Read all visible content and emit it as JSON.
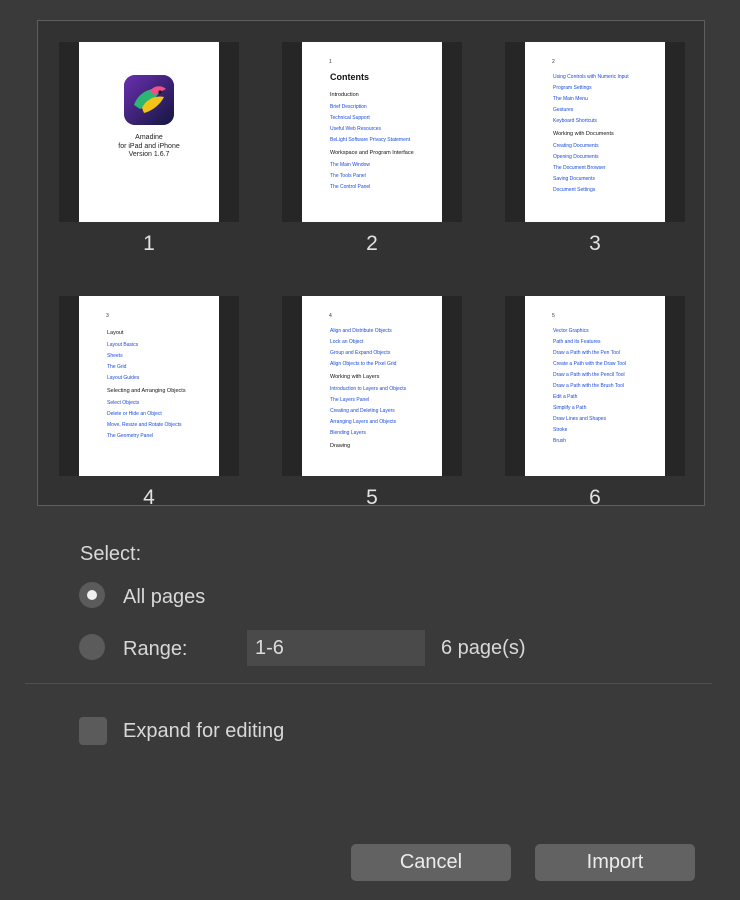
{
  "pages": [
    {
      "number": "1",
      "type": "cover",
      "cover": {
        "line1": "Amadine",
        "line2": "for iPad and iPhone",
        "line3": "Version 1.6.7"
      }
    },
    {
      "number": "2",
      "page_no": "1",
      "heading": "Contents",
      "lines": [
        {
          "t": "Introduction",
          "s": true
        },
        {
          "t": "Brief Description",
          "s": false
        },
        {
          "t": "Technical Support",
          "s": false
        },
        {
          "t": "Useful Web Resources",
          "s": false
        },
        {
          "t": "BeLight Software Privacy Statement",
          "s": false
        },
        {
          "t": "Workspace and Program Interface",
          "s": true
        },
        {
          "t": "The Main Window",
          "s": false
        },
        {
          "t": "The Tools Panel",
          "s": false
        },
        {
          "t": "The Control Panel",
          "s": false
        }
      ]
    },
    {
      "number": "3",
      "page_no": "2",
      "heading": "",
      "lines": [
        {
          "t": "Using Controls with Numeric Input",
          "s": false
        },
        {
          "t": "Program Settings",
          "s": false
        },
        {
          "t": "The Main Menu",
          "s": false
        },
        {
          "t": "Gestures",
          "s": false
        },
        {
          "t": "Keyboard Shortcuts",
          "s": false
        },
        {
          "t": "Working with Documents",
          "s": true
        },
        {
          "t": "Creating Documents",
          "s": false
        },
        {
          "t": "Opening Documents",
          "s": false
        },
        {
          "t": "The Document Browser",
          "s": false
        },
        {
          "t": "Saving Documents",
          "s": false
        },
        {
          "t": "Document Settings",
          "s": false
        }
      ]
    },
    {
      "number": "4",
      "page_no": "3",
      "heading": "",
      "lines": [
        {
          "t": "Layout",
          "s": true
        },
        {
          "t": "Layout Basics",
          "s": false
        },
        {
          "t": "Sheets",
          "s": false
        },
        {
          "t": "The Grid",
          "s": false
        },
        {
          "t": "Layout Guides",
          "s": false
        },
        {
          "t": "Selecting and Arranging Objects",
          "s": true
        },
        {
          "t": "Select Objects",
          "s": false
        },
        {
          "t": "Delete or Hide an Object",
          "s": false
        },
        {
          "t": "Move, Resize and Rotate Objects",
          "s": false
        },
        {
          "t": "The Geometry Panel",
          "s": false
        }
      ]
    },
    {
      "number": "5",
      "page_no": "4",
      "heading": "",
      "lines": [
        {
          "t": "Align and Distribute Objects",
          "s": false
        },
        {
          "t": "Lock an Object",
          "s": false
        },
        {
          "t": "Group and Expand Objects",
          "s": false
        },
        {
          "t": "Align Objects to the Pixel Grid",
          "s": false
        },
        {
          "t": "Working with Layers",
          "s": true
        },
        {
          "t": "Introduction to Layers and Objects",
          "s": false
        },
        {
          "t": "The Layers Panel",
          "s": false
        },
        {
          "t": "Creating and Deleting Layers",
          "s": false
        },
        {
          "t": "Arranging Layers and Objects",
          "s": false
        },
        {
          "t": "Blending Layers",
          "s": false
        },
        {
          "t": "Drawing",
          "s": true
        }
      ]
    },
    {
      "number": "6",
      "page_no": "5",
      "heading": "",
      "lines": [
        {
          "t": "Vector Graphics",
          "s": false
        },
        {
          "t": "Path and its Features",
          "s": false
        },
        {
          "t": "Draw a Path with the Pen Tool",
          "s": false
        },
        {
          "t": "Create a Path with the Draw Tool",
          "s": false
        },
        {
          "t": "Draw a Path with the Pencil Tool",
          "s": false
        },
        {
          "t": "Draw a Path with the Brush Tool",
          "s": false
        },
        {
          "t": "Edit a Path",
          "s": false
        },
        {
          "t": "Simplify a Path",
          "s": false
        },
        {
          "t": "Draw Lines and Shapes",
          "s": false
        },
        {
          "t": "Stroke",
          "s": false
        },
        {
          "t": "Brush",
          "s": false
        }
      ]
    }
  ],
  "select": {
    "label": "Select:",
    "all_pages_label": "All pages",
    "all_pages_checked": true,
    "range_label": "Range:",
    "range_value": "1-6",
    "page_count": "6 page(s)"
  },
  "expand_label": "Expand for editing",
  "expand_checked": false,
  "buttons": {
    "cancel": "Cancel",
    "import": "Import"
  },
  "colors": {
    "background": "#3a3a3a",
    "link": "#1a4bdb",
    "button": "#626262"
  },
  "icons": {
    "app_icon": "amadine-bird-icon"
  }
}
